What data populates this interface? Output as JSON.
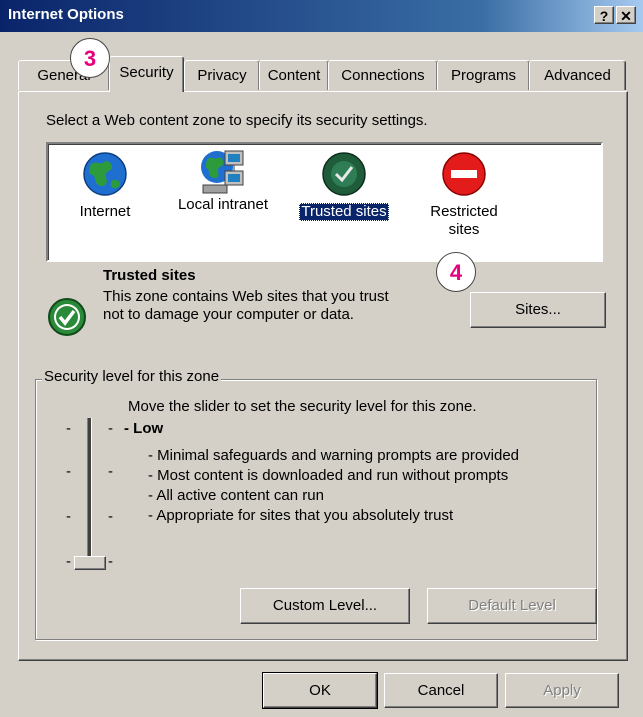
{
  "window": {
    "title": "Internet Options",
    "help_button": "?",
    "close_button": "✕"
  },
  "tabs": [
    {
      "label": "General"
    },
    {
      "label": "Security"
    },
    {
      "label": "Privacy"
    },
    {
      "label": "Content"
    },
    {
      "label": "Connections"
    },
    {
      "label": "Programs"
    },
    {
      "label": "Advanced"
    }
  ],
  "security": {
    "instruction": "Select a Web content zone to specify its security settings.",
    "zones": [
      {
        "label": "Internet"
      },
      {
        "label": "Local intranet"
      },
      {
        "label": "Trusted sites"
      },
      {
        "label": "Restricted sites"
      }
    ],
    "selected_zone_title": "Trusted sites",
    "selected_zone_description": "This zone contains Web sites that you trust not to damage your computer or data.",
    "sites_button": "Sites...",
    "level_group_label": "Security level for this zone",
    "slider_instruction": "Move the slider to set the security level for this zone.",
    "level_name": "Low",
    "level_items": [
      "- Minimal safeguards and warning prompts are provided",
      "- Most content is downloaded and run without prompts",
      "- All active content can run",
      "- Appropriate for sites that you absolutely trust"
    ],
    "slider_level_index": 0,
    "slider_level_count": 4,
    "custom_level_button": "Custom Level...",
    "default_level_button": "Default Level"
  },
  "footer": {
    "ok_button": "OK",
    "cancel_button": "Cancel",
    "apply_button": "Apply"
  },
  "callouts": [
    {
      "number": "3"
    },
    {
      "number": "4"
    }
  ],
  "colors": {
    "title_bar": "#0a246a",
    "callout_number": "#e6007e",
    "selection": "#0a246a"
  }
}
